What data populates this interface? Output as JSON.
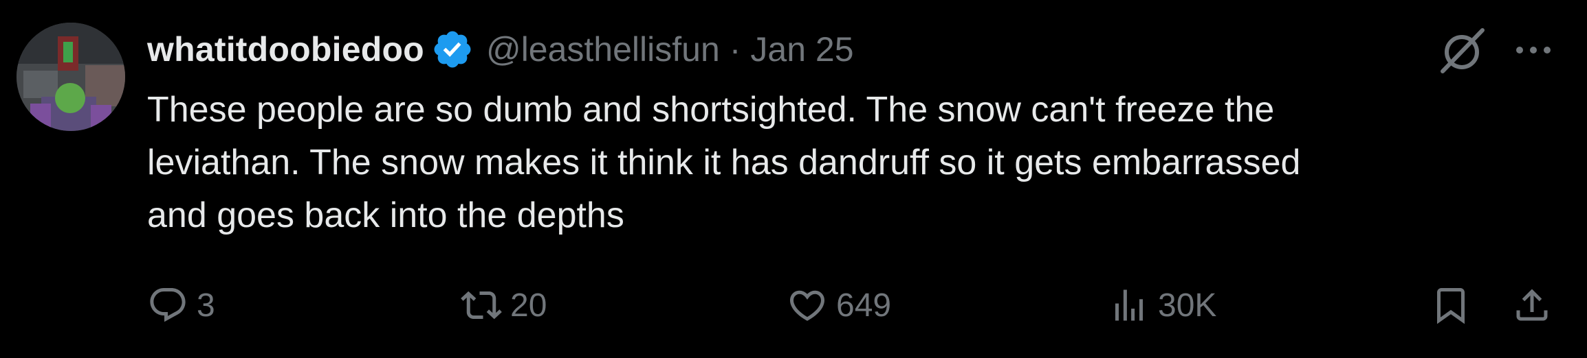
{
  "tweet": {
    "display_name": "whatitdoobiedoo",
    "handle": "@leasthellisfun",
    "separator": "·",
    "date": "Jan 25",
    "text_lines": [
      "These people are so dumb and shortsighted. The snow can't freeze the",
      "leviathan. The snow makes it think it has dandruff so it gets embarrassed",
      "and goes back into the depths"
    ],
    "verified": true
  },
  "actions": {
    "replies": "3",
    "retweets": "20",
    "likes": "649",
    "views": "30K"
  },
  "icons": {
    "verified": "verified-badge-icon",
    "grok": "grok-icon",
    "more": "more-icon",
    "reply": "reply-icon",
    "retweet": "retweet-icon",
    "like": "heart-icon",
    "views": "views-icon",
    "bookmark": "bookmark-icon",
    "share": "share-icon"
  },
  "colors": {
    "background": "#000000",
    "text_primary": "#e7e9ea",
    "text_secondary": "#71767b",
    "verified_blue": "#1d9bf0"
  }
}
